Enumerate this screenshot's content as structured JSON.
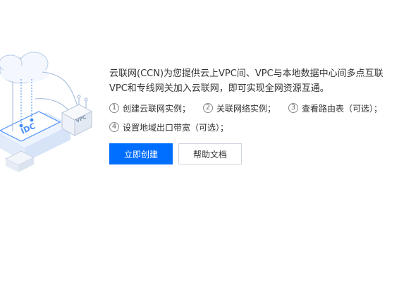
{
  "intro": {
    "line1": "云联网(CCN)为您提供云上VPC间、VPC与本地数据中心间多点互联",
    "line2": "VPC和专线网关加入云联网，即可实现全网资源互通。"
  },
  "steps": [
    {
      "num": "1",
      "label": "创建云联网实例；"
    },
    {
      "num": "2",
      "label": "关联网络实例；"
    },
    {
      "num": "3",
      "label": "查看路由表（可选）；"
    },
    {
      "num": "4",
      "label": "设置地域出口带宽（可选）；"
    }
  ],
  "buttons": {
    "primary": "立即创建",
    "secondary": "帮助文档"
  },
  "illustration": {
    "vpc_label": "VPC",
    "idc_label": "IDC",
    "accent": "#006eff"
  }
}
